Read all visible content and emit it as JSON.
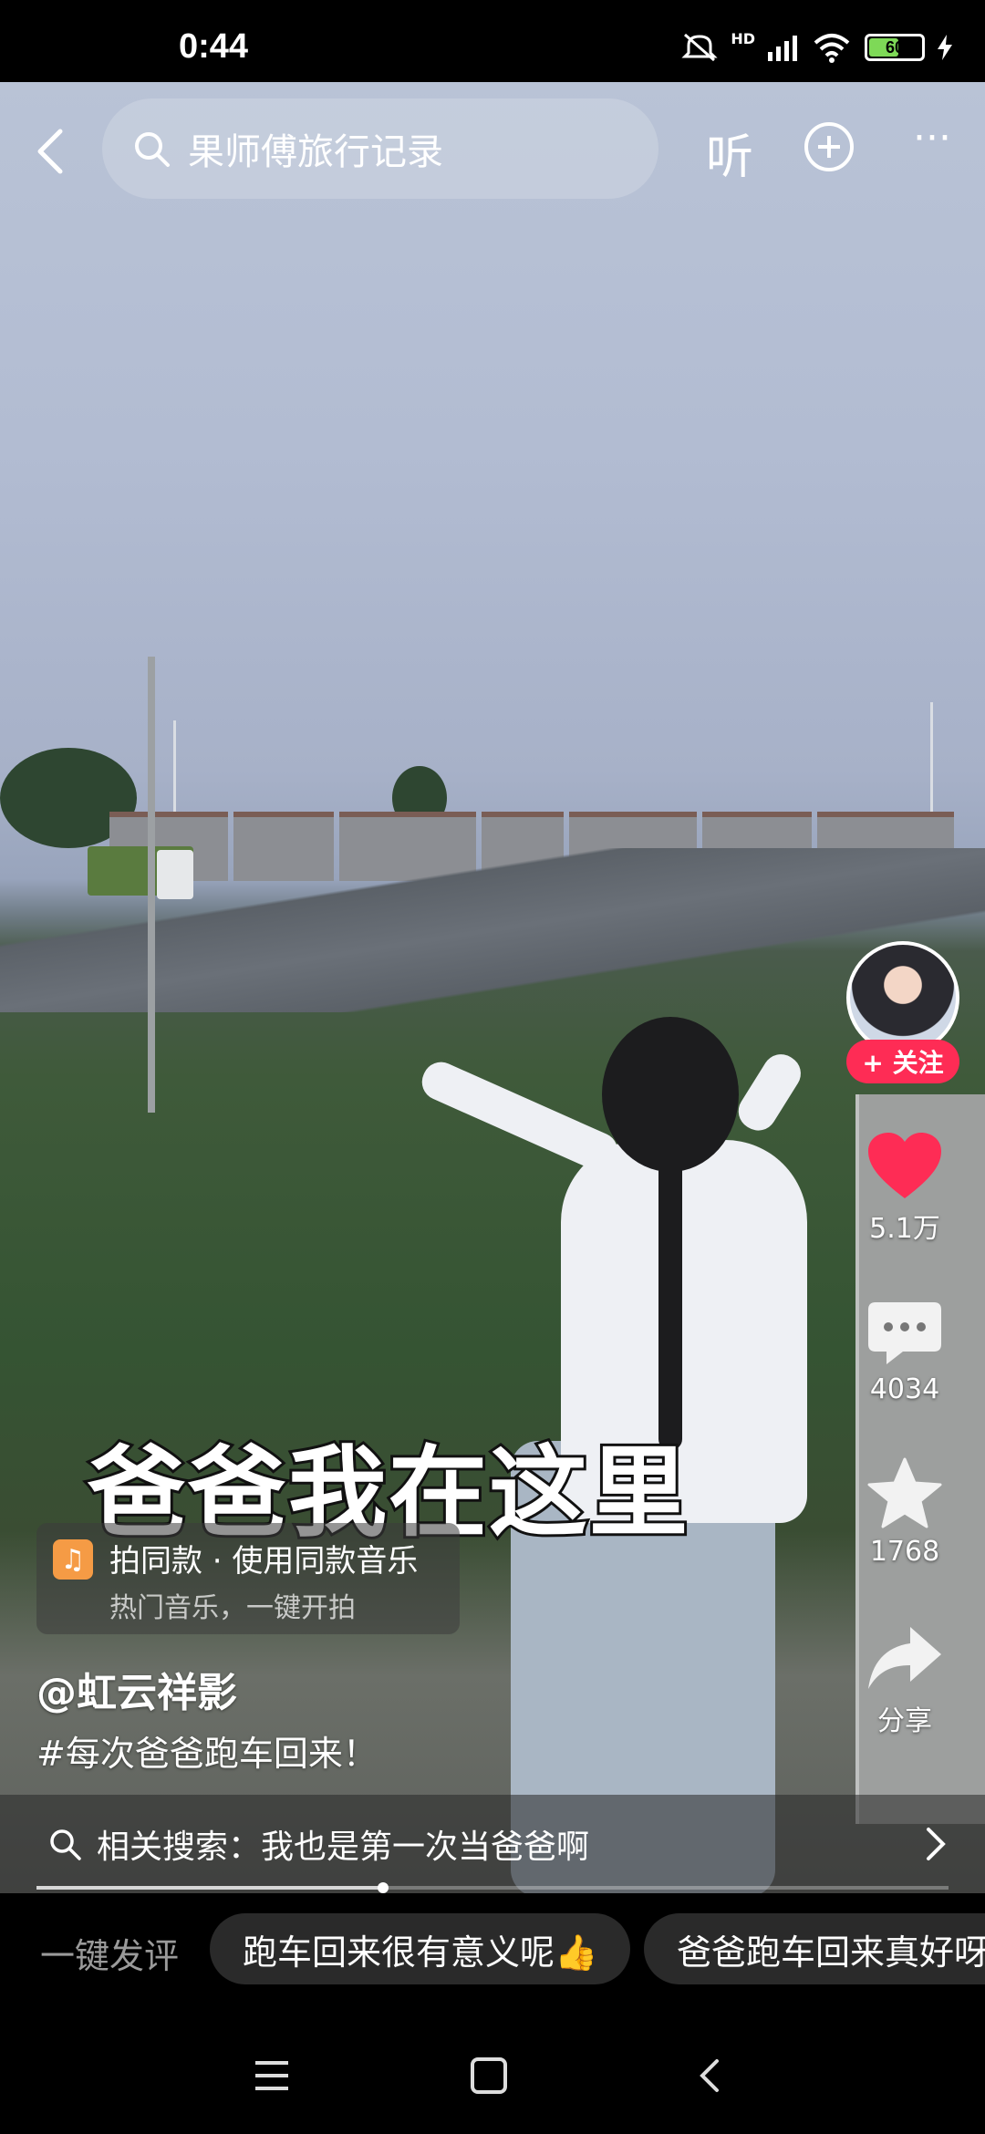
{
  "status_bar": {
    "time": "0:44",
    "network": "HD",
    "battery": "60",
    "battery_level": 0.6
  },
  "header": {
    "search_text": "果师傅旅行记录",
    "listen_label": "听",
    "more_label": "···"
  },
  "video": {
    "caption": "爸爸我在这里"
  },
  "sidebar": {
    "follow_label": "+ 关注",
    "likes": "5.1万",
    "comments": "4034",
    "favorites": "1768",
    "share_label": "分享"
  },
  "music": {
    "title": "拍同款 · 使用同款音乐",
    "subtitle": "热门音乐，一键开拍"
  },
  "post": {
    "author": "@虹云祥影",
    "hashtag": "#每次爸爸跑车回来！"
  },
  "related": {
    "text": "相关搜索：我也是第一次当爸爸啊"
  },
  "progress": 0.38,
  "quick_comment": {
    "label": "一键发评",
    "chips": [
      "跑车回来很有意义呢👍",
      "爸爸跑车回来真好呀"
    ]
  },
  "colors": {
    "accent": "#fe2c55",
    "like": "#fe2c55",
    "music_icon": "#f59b45"
  }
}
